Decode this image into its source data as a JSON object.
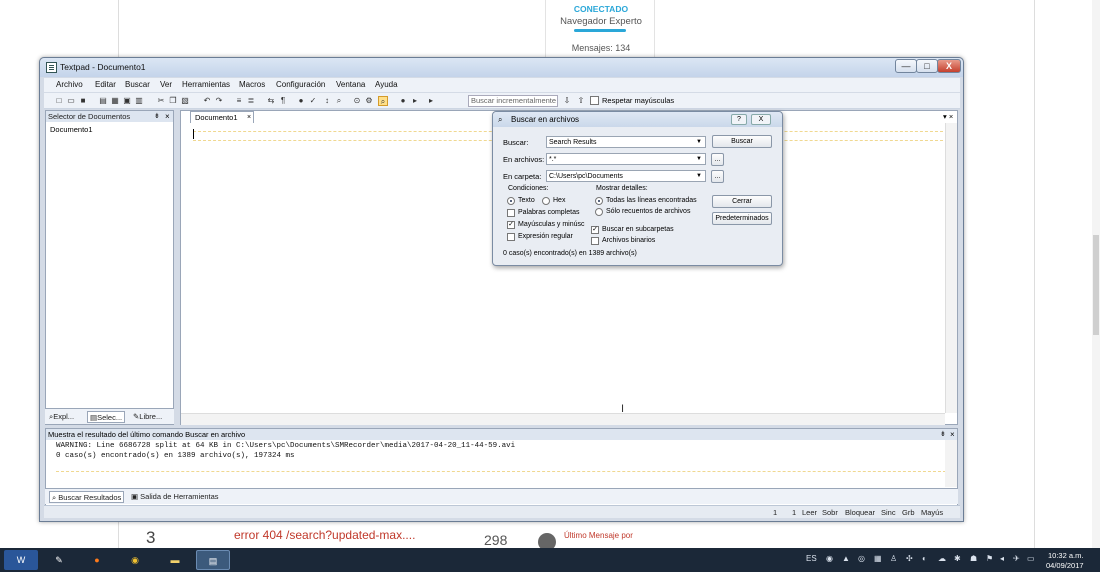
{
  "background": {
    "status": "CONECTADO",
    "role": "Navegador Experto",
    "messages": "Mensajes: 134",
    "row_number": "3",
    "row_link": "error 404 /search?updated-max....",
    "row_count": "298",
    "row_last": "Último Mensaje por"
  },
  "window": {
    "title": "Textpad - Documento1",
    "min": "—",
    "max": "□",
    "close": "X"
  },
  "menu": [
    "Archivo",
    "Editar",
    "Buscar",
    "Ver",
    "Herramientas",
    "Macros",
    "Configuración",
    "Ventana",
    "Ayuda"
  ],
  "toolbar": {
    "incremental_placeholder": "Buscar incrementalmente",
    "case_label": "Respetar mayúsculas"
  },
  "doc_selector": {
    "header": "Selector de Documentos",
    "pin": "⇟",
    "close": "×",
    "item": "Documento1",
    "tabs": [
      "Expl...",
      "Selec...",
      "Libre..."
    ]
  },
  "editor": {
    "tab_label": "Documento1",
    "tab_close": "×",
    "tabbar_controls": "▾ ×"
  },
  "output": {
    "header": "Muestra el resultado del último comando Buscar en archivo",
    "pin": "⇟",
    "close": "×",
    "line1": "WARNING: Line 6686728 split at 64 KB in C:\\Users\\pc\\Documents\\SMRecorder\\media\\2017-04-20_11-44-59.avi",
    "line2": "0 caso(s) encontrado(s) en 1389 archivo(s), 197324 ms",
    "tabs": [
      "Buscar Resultados",
      "Salida de Herramientas"
    ]
  },
  "statusbar": {
    "line": "1",
    "col": "1",
    "items": [
      "Leer",
      "Sobr",
      "Bloquear",
      "Sinc",
      "Grb",
      "Mayús"
    ]
  },
  "dialog": {
    "title": "Buscar en archivos",
    "help": "?",
    "close": "X",
    "search_label": "Buscar:",
    "search_value": "Search Results",
    "files_label": "En archivos:",
    "files_value": "*.*",
    "folder_label": "En carpeta:",
    "folder_value": "C:\\Users\\pc\\Documents",
    "browse": "...",
    "btn_search": "Buscar",
    "btn_close": "Cerrar",
    "btn_defaults": "Predeterminados",
    "conditions_label": "Condiciones:",
    "opt_text": "Texto",
    "opt_hex": "Hex",
    "opt_whole": "Palabras completas",
    "opt_case": "Mayúsculas y minúsc",
    "opt_regex": "Expresión regular",
    "show_label": "Mostrar detalles:",
    "opt_all_lines": "Todas las líneas encontradas",
    "opt_counts": "Sólo recuentos de archivos",
    "opt_subfolders": "Buscar en subcarpetas",
    "opt_binary": "Archivos binarios",
    "result": "0 caso(s) encontrado(s) en 1389 archivo(s)"
  },
  "taskbar": {
    "lang": "ES",
    "time": "10:32 a.m.",
    "date": "04/09/2017"
  }
}
